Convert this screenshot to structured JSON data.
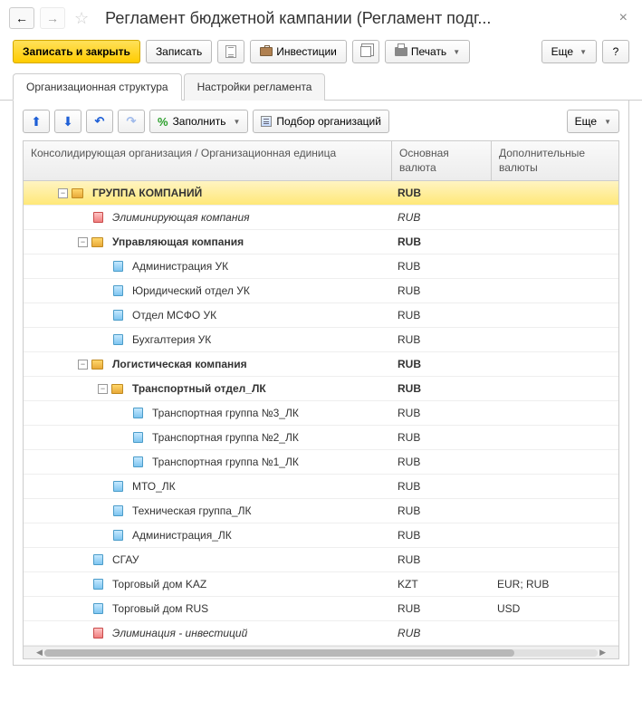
{
  "header": {
    "title": "Регламент бюджетной кампании (Регламент подг..."
  },
  "toolbar": {
    "save_close": "Записать и закрыть",
    "save": "Записать",
    "invest": "Инвестиции",
    "print": "Печать",
    "more": "Еще",
    "help": "?"
  },
  "tabs": {
    "org": "Организационная структура",
    "settings": "Настройки регламента"
  },
  "subtoolbar": {
    "fill": "Заполнить",
    "select_org": "Подбор организаций",
    "more": "Еще"
  },
  "columns": {
    "col1": "Консолидирующая организация / Организационная единица",
    "col2": "Основная валюта",
    "col3": "Дополнительные валюты"
  },
  "rows": [
    {
      "indent": 0,
      "expand": "minus",
      "icon": "folder",
      "name": "ГРУППА КОМПАНИЙ",
      "bold": true,
      "italic": false,
      "c1": "RUB",
      "c1bold": true,
      "c2": "",
      "selected": true
    },
    {
      "indent": 1,
      "expand": "none",
      "icon": "red",
      "name": "Элиминирующая компания",
      "bold": false,
      "italic": true,
      "c1": "RUB",
      "c1italic": true,
      "c2": ""
    },
    {
      "indent": 1,
      "expand": "minus",
      "icon": "folder",
      "name": "Управляющая компания",
      "bold": true,
      "italic": false,
      "c1": "RUB",
      "c1bold": true,
      "c2": ""
    },
    {
      "indent": 2,
      "expand": "none",
      "icon": "item",
      "name": "Администрация УК",
      "bold": false,
      "italic": false,
      "c1": "RUB",
      "c2": ""
    },
    {
      "indent": 2,
      "expand": "none",
      "icon": "item",
      "name": "Юридический отдел УК",
      "bold": false,
      "italic": false,
      "c1": "RUB",
      "c2": ""
    },
    {
      "indent": 2,
      "expand": "none",
      "icon": "item",
      "name": "Отдел МСФО УК",
      "bold": false,
      "italic": false,
      "c1": "RUB",
      "c2": ""
    },
    {
      "indent": 2,
      "expand": "none",
      "icon": "item",
      "name": "Бухгалтерия УК",
      "bold": false,
      "italic": false,
      "c1": "RUB",
      "c2": ""
    },
    {
      "indent": 1,
      "expand": "minus",
      "icon": "folder",
      "name": "Логистическая компания",
      "bold": true,
      "italic": false,
      "c1": "RUB",
      "c1bold": true,
      "c2": ""
    },
    {
      "indent": 2,
      "expand": "minus",
      "icon": "folder",
      "name": "Транспортный отдел_ЛК",
      "bold": true,
      "italic": false,
      "c1": "RUB",
      "c1bold": true,
      "c2": ""
    },
    {
      "indent": 3,
      "expand": "none",
      "icon": "item",
      "name": "Транспортная группа №3_ЛК",
      "bold": false,
      "italic": false,
      "c1": "RUB",
      "c2": ""
    },
    {
      "indent": 3,
      "expand": "none",
      "icon": "item",
      "name": "Транспортная группа №2_ЛК",
      "bold": false,
      "italic": false,
      "c1": "RUB",
      "c2": ""
    },
    {
      "indent": 3,
      "expand": "none",
      "icon": "item",
      "name": "Транспортная группа №1_ЛК",
      "bold": false,
      "italic": false,
      "c1": "RUB",
      "c2": ""
    },
    {
      "indent": 2,
      "expand": "none",
      "icon": "item",
      "name": "МТО_ЛК",
      "bold": false,
      "italic": false,
      "c1": "RUB",
      "c2": ""
    },
    {
      "indent": 2,
      "expand": "none",
      "icon": "item",
      "name": "Техническая группа_ЛК",
      "bold": false,
      "italic": false,
      "c1": "RUB",
      "c2": ""
    },
    {
      "indent": 2,
      "expand": "none",
      "icon": "item",
      "name": "Администрация_ЛК",
      "bold": false,
      "italic": false,
      "c1": "RUB",
      "c2": ""
    },
    {
      "indent": 1,
      "expand": "none",
      "icon": "item",
      "name": "СГАУ",
      "bold": false,
      "italic": false,
      "c1": "RUB",
      "c2": ""
    },
    {
      "indent": 1,
      "expand": "none",
      "icon": "item",
      "name": "Торговый дом KAZ",
      "bold": false,
      "italic": false,
      "c1": "KZT",
      "c2": "EUR; RUB"
    },
    {
      "indent": 1,
      "expand": "none",
      "icon": "item",
      "name": "Торговый дом RUS",
      "bold": false,
      "italic": false,
      "c1": "RUB",
      "c2": "USD"
    },
    {
      "indent": 1,
      "expand": "none",
      "icon": "red",
      "name": "Элиминация - инвестиций",
      "bold": false,
      "italic": true,
      "c1": "RUB",
      "c1italic": true,
      "c2": ""
    }
  ]
}
